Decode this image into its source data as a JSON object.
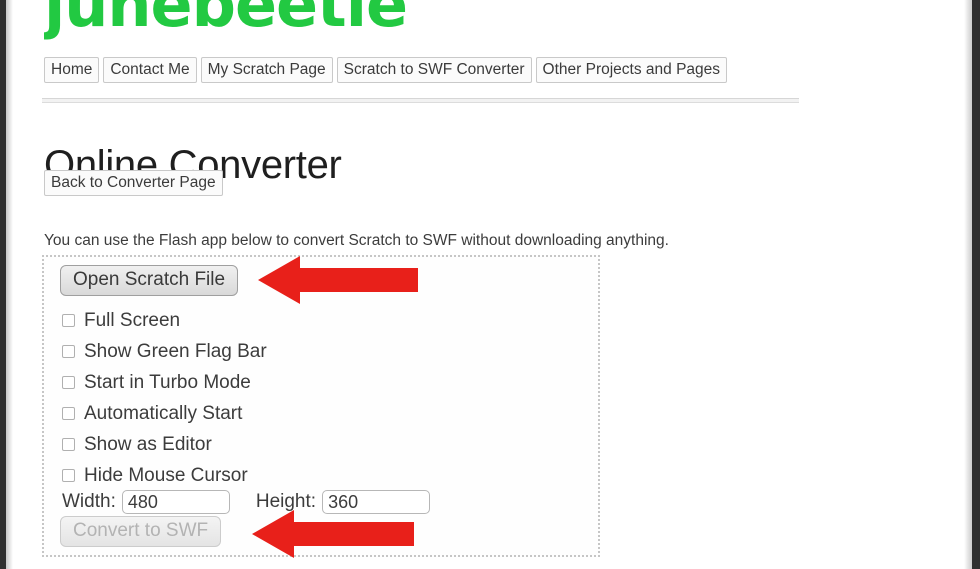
{
  "site": {
    "logo_text": "junebeetle",
    "logo_color": "#22c942"
  },
  "nav": {
    "items": [
      {
        "label": "Home"
      },
      {
        "label": "Contact Me"
      },
      {
        "label": "My Scratch Page"
      },
      {
        "label": "Scratch to SWF Converter"
      },
      {
        "label": "Other Projects and Pages"
      }
    ]
  },
  "page": {
    "title": "Online Converter",
    "back_button": "Back to Converter Page",
    "intro": "You can use the Flash app below to convert Scratch to SWF without downloading anything."
  },
  "flash_app": {
    "open_button": "Open Scratch File",
    "convert_button": "Convert to SWF",
    "convert_button_disabled": true,
    "options": [
      {
        "label": "Full Screen",
        "checked": false
      },
      {
        "label": "Show Green Flag Bar",
        "checked": false
      },
      {
        "label": "Start in Turbo Mode",
        "checked": false
      },
      {
        "label": "Automatically Start",
        "checked": false
      },
      {
        "label": "Show as Editor",
        "checked": false
      },
      {
        "label": "Hide Mouse Cursor",
        "checked": false
      }
    ],
    "width_label": "Width:",
    "width_value": "480",
    "height_label": "Height:",
    "height_value": "360"
  },
  "annotations": {
    "color": "#e8201a",
    "arrows": [
      {
        "points_to": "Open Scratch File",
        "direction": "left"
      },
      {
        "points_to": "Convert to SWF",
        "direction": "left"
      }
    ]
  }
}
